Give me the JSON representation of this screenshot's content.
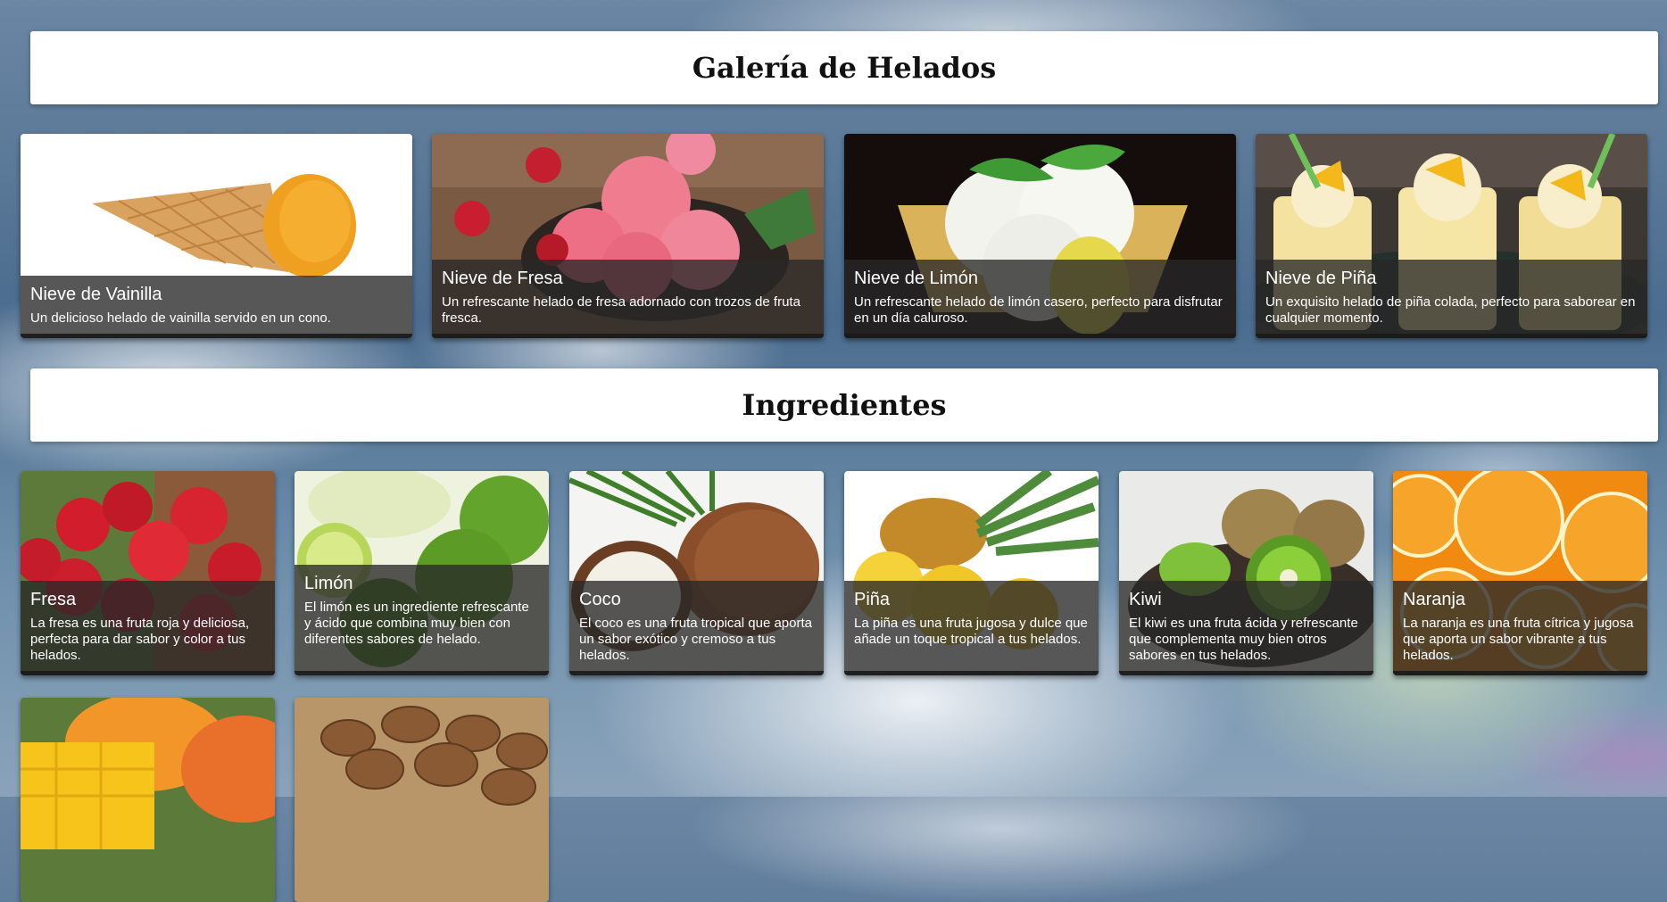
{
  "gallery": {
    "title": "Galería de Helados",
    "items": [
      {
        "name": "Nieve de Vainilla",
        "description": "Un delicioso helado de vainilla servido en un cono."
      },
      {
        "name": "Nieve de Fresa",
        "description": "Un refrescante helado de fresa adornado con trozos de fruta fresca."
      },
      {
        "name": "Nieve de Limón",
        "description": "Un refrescante helado de limón casero, perfecto para disfrutar en un día caluroso."
      },
      {
        "name": "Nieve de Piña",
        "description": "Un exquisito helado de piña colada, perfecto para saborear en cualquier momento."
      }
    ]
  },
  "ingredients": {
    "title": "Ingredientes",
    "items": [
      {
        "name": "Fresa",
        "description": "La fresa es una fruta roja y deliciosa, perfecta para dar sabor y color a tus helados."
      },
      {
        "name": "Limón",
        "description": "El limón es un ingrediente refrescante y ácido que combina muy bien con diferentes sabores de helado."
      },
      {
        "name": "Coco",
        "description": "El coco es una fruta tropical que aporta un sabor exótico y cremoso a tus helados."
      },
      {
        "name": "Piña",
        "description": "La piña es una fruta jugosa y dulce que añade un toque tropical a tus helados."
      },
      {
        "name": "Kiwi",
        "description": "El kiwi es una fruta ácida y refrescante que complementa muy bien otros sabores en tus helados."
      },
      {
        "name": "Naranja",
        "description": "La naranja es una fruta cítrica y jugosa que aporta un sabor vibrante a tus helados."
      }
    ]
  }
}
